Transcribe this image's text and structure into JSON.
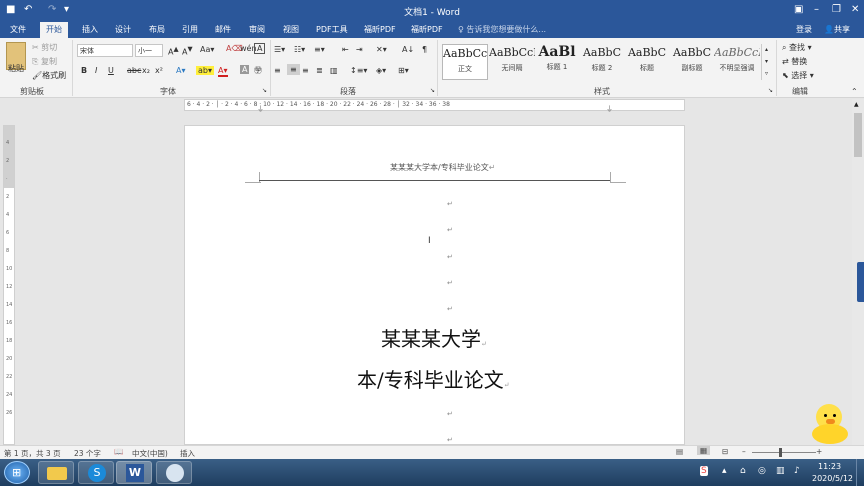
{
  "window": {
    "title": "文档1 - Word",
    "login": "登录",
    "share": "共享"
  },
  "tabs": [
    "文件",
    "开始",
    "插入",
    "设计",
    "布局",
    "引用",
    "邮件",
    "审阅",
    "视图",
    "PDF工具",
    "福昕PDF",
    "福昕PDF"
  ],
  "tell_me": "告诉我您想要做什么...",
  "clipboard": {
    "paste": "粘贴",
    "cut": "剪切",
    "copy": "复制",
    "painter": "格式刷",
    "label": "剪贴板"
  },
  "font": {
    "name": "宋体",
    "size": "小一",
    "label": "字体",
    "buttons": [
      "B",
      "I",
      "U",
      "abc",
      "x₂",
      "x²"
    ]
  },
  "paragraph": {
    "label": "段落"
  },
  "styles": {
    "label": "样式",
    "items": [
      {
        "preview": "AaBbCcDc",
        "name": "正文"
      },
      {
        "preview": "AaBbCcDc",
        "name": "无间隔"
      },
      {
        "preview": "AaBl",
        "name": "标题 1"
      },
      {
        "preview": "AaBbC",
        "name": "标题 2"
      },
      {
        "preview": "AaBbC",
        "name": "标题"
      },
      {
        "preview": "AaBbC",
        "name": "副标题"
      },
      {
        "preview": "AaBbCcDc",
        "name": "不明显强调"
      }
    ]
  },
  "editing": {
    "find": "查找",
    "replace": "替换",
    "select": "选择",
    "label": "编辑"
  },
  "document": {
    "header_text": "某某某大学本/专科毕业论文",
    "title1": "某某某大学",
    "title2": "本/专科毕业论文"
  },
  "status": {
    "page": "第 1 页，共 3 页",
    "words": "23 个字",
    "lang": "中文(中国)",
    "mode": "插入"
  },
  "taskbar": {
    "time": "11:23",
    "date": "2020/5/12"
  },
  "colors": {
    "accent": "#2b579a"
  }
}
